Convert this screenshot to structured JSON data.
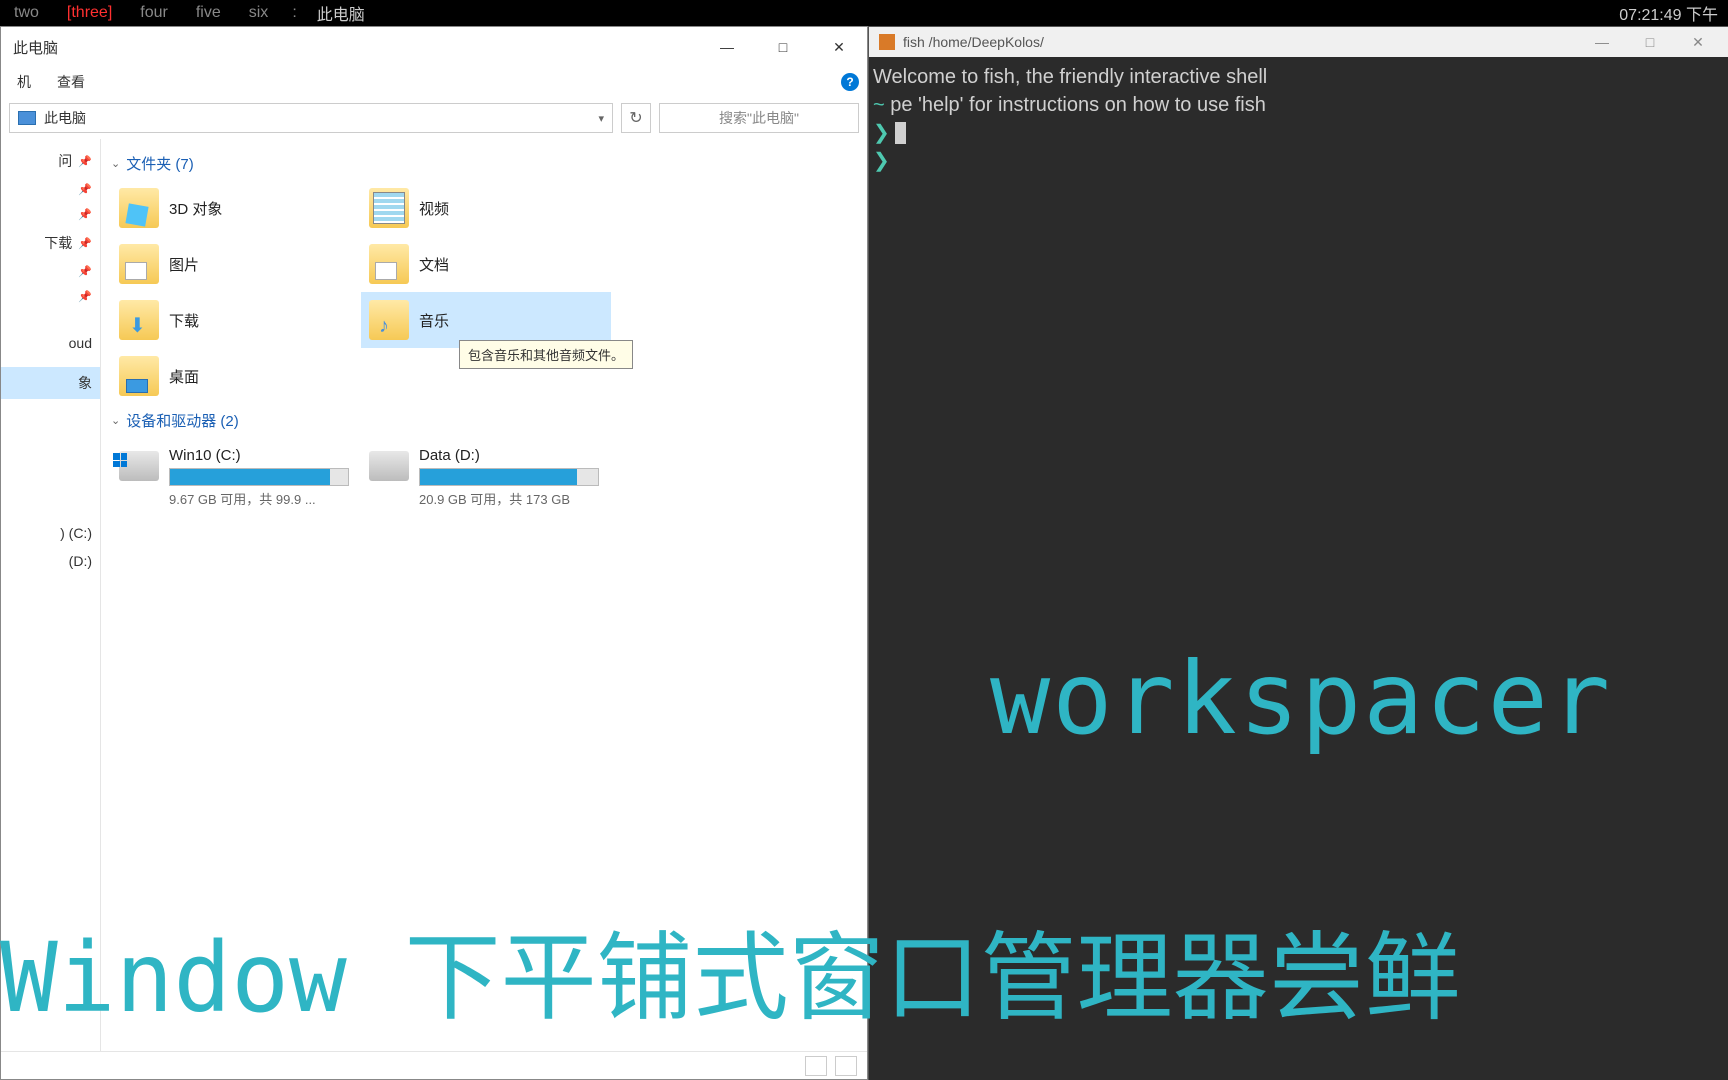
{
  "wsbar": {
    "items": [
      "two",
      "[three]",
      "four",
      "five",
      "six"
    ],
    "active_index": 1,
    "separator": ":",
    "title": "此电脑",
    "clock": "07:21:49 下午"
  },
  "explorer": {
    "title": "此电脑",
    "menu": {
      "machine": "机",
      "view": "查看"
    },
    "breadcrumb": "此电脑",
    "search_placeholder": "搜索\"此电脑\"",
    "sidebar": {
      "items": [
        {
          "label": "问",
          "pin": true
        },
        {
          "label": "",
          "pin": true
        },
        {
          "label": "",
          "pin": true
        },
        {
          "label": "下载",
          "pin": true
        },
        {
          "label": "",
          "pin": true
        },
        {
          "label": "",
          "pin": true
        }
      ],
      "cloud": "oud",
      "thispc_sel": "象",
      "drive_c": ") (C:)",
      "drive_d": "(D:)"
    },
    "groups": {
      "folders": {
        "header": "文件夹 (7)"
      },
      "devices": {
        "header": "设备和驱动器 (2)"
      }
    },
    "folders": [
      {
        "label": "3D 对象",
        "type": "cube"
      },
      {
        "label": "视频",
        "type": "vid"
      },
      {
        "label": "图片",
        "type": "pic"
      },
      {
        "label": "文档",
        "type": "doc"
      },
      {
        "label": "下载",
        "type": "arrow"
      },
      {
        "label": "音乐",
        "type": "note",
        "sel": true,
        "tooltip": "包含音乐和其他音频文件。"
      },
      {
        "label": "桌面",
        "type": "desk"
      }
    ],
    "drives": [
      {
        "name": "Win10 (C:)",
        "fill": 90,
        "text": "9.67 GB 可用，共 99.9 ...",
        "win": true
      },
      {
        "name": "Data (D:)",
        "fill": 88,
        "text": "20.9 GB 可用，共 173 GB",
        "win": false
      }
    ]
  },
  "terminal": {
    "title": "fish /home/DeepKolos/",
    "lines": [
      "Welcome to fish, the friendly interactive shell",
      "pe 'help' for instructions on how to use fish"
    ],
    "prompt_sym": "~",
    "prompt_arrow": "❯"
  },
  "overlay": {
    "big1": "workspacer",
    "big2": "Window 下平铺式窗口管理器尝鲜"
  }
}
